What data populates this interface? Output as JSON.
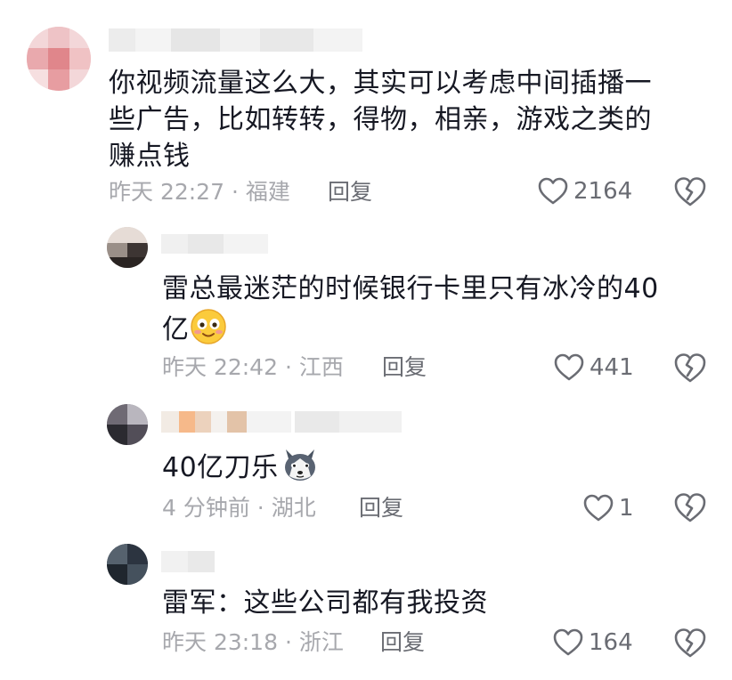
{
  "comments": [
    {
      "text_lines": [
        "你视频流量这么大，其实可以考虑中间插播一",
        "些广告，比如转转，得物，相亲，游戏之类的",
        "赚点钱"
      ],
      "meta": "昨天 22:27 · 福建",
      "reply_label": "回复",
      "likes": "2164"
    },
    {
      "text_lines": [
        "雷总最迷茫的时候银行卡里只有冰冷的40",
        "亿"
      ],
      "meta": "昨天 22:42 · 江西",
      "reply_label": "回复",
      "likes": "441"
    },
    {
      "text_lines": [
        "40亿刀乐"
      ],
      "meta": "4 分钟前 · 湖北",
      "reply_label": "回复",
      "likes": "1"
    },
    {
      "text_lines": [
        "雷军：这些公司都有我投资"
      ],
      "meta": "昨天 23:18 · 浙江",
      "reply_label": "回复",
      "likes": "164"
    }
  ],
  "colors": {
    "text": "#161823",
    "meta": "#a7a8ad",
    "action": "#6a6c73"
  },
  "icons": {
    "like": "heart-outline-icon",
    "dislike": "broken-heart-icon",
    "emoji_1": "smiling-face-emoji",
    "emoji_2": "husky-dog-emoji"
  }
}
